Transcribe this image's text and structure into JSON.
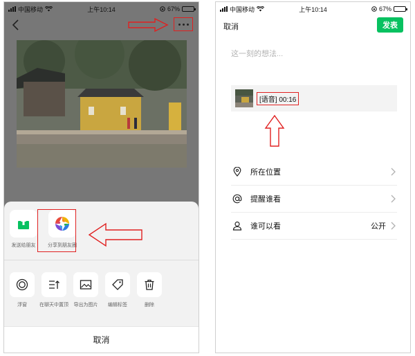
{
  "left": {
    "status": {
      "carrier": "中国移动",
      "time": "上午10:14",
      "battery": "67%",
      "battery_level": 0.67
    },
    "share": [
      {
        "label": "发送给朋友"
      },
      {
        "label": "分享到朋友圈"
      }
    ],
    "actions": [
      {
        "label": "浮窗",
        "icon": "float-window-icon"
      },
      {
        "label": "在聊天中置顶",
        "icon": "pin-top-icon"
      },
      {
        "label": "导出为图片",
        "icon": "image-icon"
      },
      {
        "label": "编辑标签",
        "icon": "tag-icon"
      },
      {
        "label": "删除",
        "icon": "trash-icon"
      }
    ],
    "cancel": "取消"
  },
  "right": {
    "status": {
      "carrier": "中国移动",
      "time": "上午10:14",
      "battery": "67%",
      "battery_level": 0.67
    },
    "cancel": "取消",
    "publish": "发表",
    "placeholder": "这一刻的想法...",
    "voice_label": "[语音] 00:16",
    "list": [
      {
        "label": "所在位置",
        "value": "",
        "icon": "location-pin-icon"
      },
      {
        "label": "提醒谁看",
        "value": "",
        "icon": "at-sign-icon"
      },
      {
        "label": "谁可以看",
        "value": "公开",
        "icon": "person-icon"
      }
    ]
  },
  "colors": {
    "accent_green": "#07c160",
    "annotation_red": "#e02020"
  }
}
